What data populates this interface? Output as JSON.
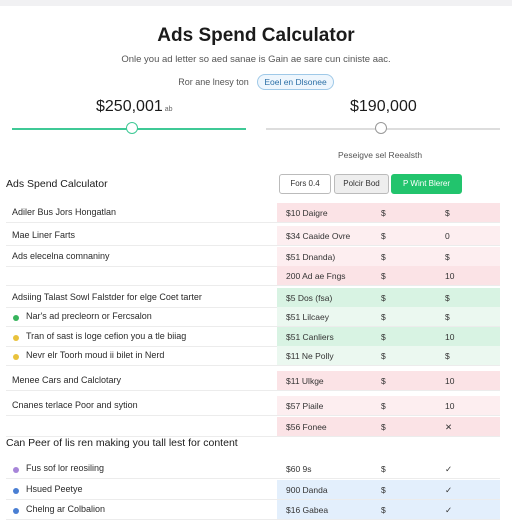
{
  "header": {
    "title": "Ads Spend Calculator",
    "subtitle": "Onle you ad letter so aed sanae is Gain ae sare cun ciniste aac.",
    "toggle_label": "Ror ane lnesy ton",
    "toggle_value": "Eoel en Dlsonee"
  },
  "amounts": {
    "left_value": "$250,001",
    "left_suffix": "ab",
    "right_value": "$190,000",
    "left_fill_percent": 48
  },
  "performance_label": "Peseigve sel Reealsth",
  "section1": {
    "title": "Ads Spend Calculator",
    "tabs": [
      "Fors 0.4",
      "Polcir Bod",
      "P Wint Blerer"
    ],
    "rows": [
      {
        "label": "Adiler Bus Jors Hongatlan",
        "c1": "$10 Daigre",
        "c2": "$",
        "c3": "$",
        "bg": "red"
      },
      {
        "label": "Mae Liner Farts",
        "c1": "$34 Caaide Ovre",
        "c2": "$",
        "c3": "0",
        "bg": "red-l"
      },
      {
        "label": "Ads elecelna comnaniny",
        "c1": "$51 Dnanda)",
        "c2": "$",
        "c3": "$",
        "bg": "red-l"
      },
      {
        "label": "",
        "c1": "200 Ad ae Fngs",
        "c2": "$",
        "c3": "10",
        "bg": "red"
      },
      {
        "label": "Adsiing Talast Sowl Falstder for elge Coet tarter",
        "c1": "$5 Dos (fsa)",
        "c2": "$",
        "c3": "$",
        "bg": "green"
      },
      {
        "label": "Nar's ad precleorn or Fercsalon",
        "c1": "$51 Lilcaey",
        "c2": "$",
        "c3": "$",
        "bg": "green-l",
        "dot": "#37b45c"
      },
      {
        "label": "Tran of sast is loge cefion you a tle biiag",
        "c1": "$51 Canliers",
        "c2": "$",
        "c3": "10",
        "bg": "green",
        "dot": "#e9c23c"
      },
      {
        "label": "Nevr elr Toorh moud ii bilet in Nerd",
        "c1": "$11 Ne Polly",
        "c2": "$",
        "c3": "$",
        "bg": "green-l",
        "dot": "#e9c23c"
      },
      {
        "label": "Menee Cars and Calclotary",
        "c1": "$11 Ulkge",
        "c2": "$",
        "c3": "10",
        "bg": "red"
      },
      {
        "label": "Cnanes terlace Poor and sytion",
        "c1": "$57 Piaile",
        "c2": "$",
        "c3": "10",
        "bg": "red-l"
      },
      {
        "label": "",
        "c1": "$56 Fonee",
        "c2": "$",
        "c3": "✕",
        "bg": "red"
      }
    ]
  },
  "section2": {
    "title": "Can Peer of lis ren making you tall lest for content",
    "rows": [
      {
        "label": "Fus sof lor reosiling",
        "c1": "$60 9s",
        "c2": "$",
        "c3": "✓",
        "bg": "white",
        "dot": "#a785d9"
      },
      {
        "label": "Hsued Peetye",
        "c1": "900 Danda",
        "c2": "$",
        "c3": "✓",
        "bg": "blue",
        "dot": "#4a7fd3"
      },
      {
        "label": "Chelng ar Colbalion",
        "c1": "$16 Gabea",
        "c2": "$",
        "c3": "✓",
        "bg": "blue",
        "dot": "#4a7fd3"
      }
    ]
  }
}
